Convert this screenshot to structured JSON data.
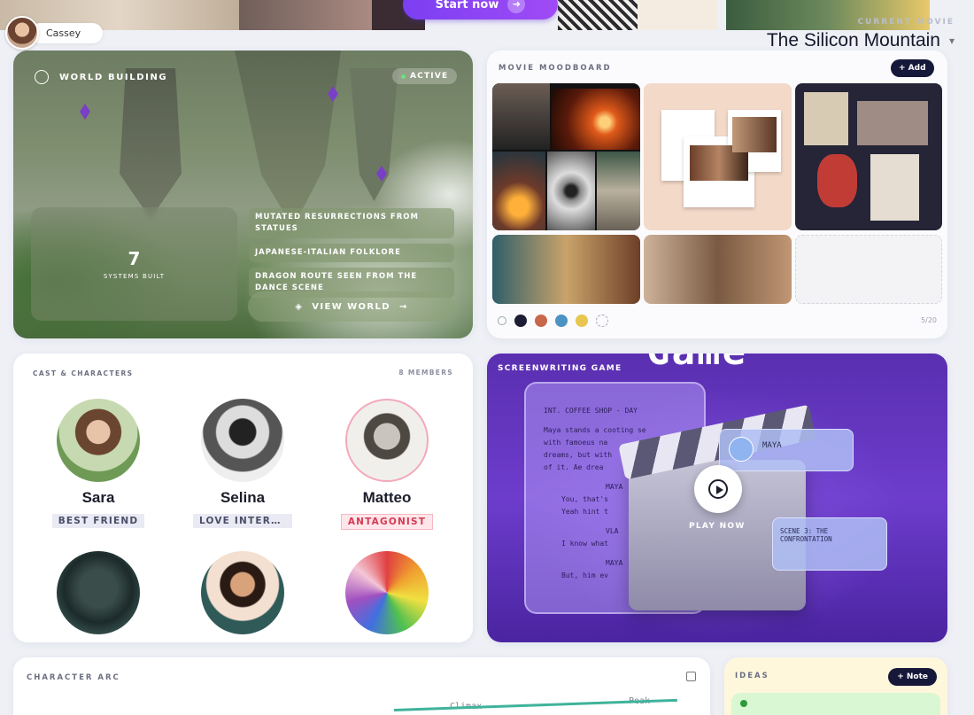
{
  "top": {
    "start_label": "Start now"
  },
  "user": {
    "name": "Cassey"
  },
  "current_movie": {
    "label": "CURRENT MOVIE",
    "title": "The Silicon Mountain"
  },
  "world_building": {
    "title": "WORLD BUILDING",
    "status": "ACTIVE",
    "stat_value": "7",
    "stat_label": "SYSTEMS BUILT",
    "tags": [
      "MUTATED RESURRECTIONS FROM STATUES",
      "JAPANESE-ITALIAN FOLKLORE",
      "DRAGON ROUTE SEEN FROM THE DANCE SCENE"
    ],
    "cta": "VIEW WORLD"
  },
  "moodboard": {
    "title": "MOVIE MOODBOARD",
    "add_label": "+ Add",
    "count": "5/20",
    "swatches": [
      "#1c1d34",
      "#c8674b",
      "#4b93c2",
      "#e8c64f"
    ]
  },
  "cast": {
    "title": "CAST & CHARACTERS",
    "count": "8 MEMBERS",
    "members": [
      {
        "name": "Sara",
        "role": "BEST FRIEND"
      },
      {
        "name": "Selina",
        "role": "LOVE INTERE…"
      },
      {
        "name": "Matteo",
        "role": "ANTAGONIST"
      }
    ]
  },
  "game": {
    "title": "SCREENWRITING GAME",
    "banner": "Game",
    "script_lines": [
      "INT. COFFEE SHOP - DAY",
      "",
      "Maya stands a cooting se",
      "with famoeus na",
      "dreams, but with",
      "of it. Ae drea",
      "",
      "MAYA",
      "You, that's",
      "Yeah hint t",
      "",
      "VLA",
      "I know what",
      "",
      "MAYA",
      "But, him ev"
    ],
    "maya_label": "MAYA",
    "scene_label": "SCENE 3: THE CONFRONTATION",
    "play_label": "PLAY NOW"
  },
  "arc": {
    "title": "CHARACTER ARC",
    "climax": "Climax",
    "peak": "Peak"
  },
  "ideas": {
    "title": "IDEAS",
    "note_label": "+ Note"
  }
}
